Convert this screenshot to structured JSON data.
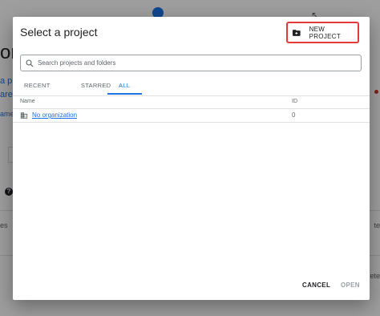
{
  "background": {
    "heading_fragment": "or",
    "link_fragments": [
      "a pr",
      "are a",
      "ame"
    ],
    "help_glyph": "?",
    "left_text": "es",
    "right_text_1": "te",
    "right_text_2": "ete",
    "arrow_glyph": "↖"
  },
  "dialog": {
    "title": "Select a project",
    "new_project_label": "NEW PROJECT",
    "search": {
      "placeholder": "Search projects and folders",
      "value": ""
    },
    "tabs": [
      {
        "label": "RECENT",
        "selected": false
      },
      {
        "label": "STARRED",
        "selected": false
      },
      {
        "label": "ALL",
        "selected": true
      }
    ],
    "table": {
      "columns": [
        "Name",
        "ID"
      ],
      "rows": [
        {
          "name": "No organization",
          "id": "0",
          "icon": "organization-icon"
        }
      ]
    },
    "actions": {
      "cancel_label": "CANCEL",
      "open_label": "OPEN"
    }
  },
  "colors": {
    "accent": "#1a73e8",
    "highlight_border": "#e53935",
    "disabled": "#9aa0a6"
  }
}
